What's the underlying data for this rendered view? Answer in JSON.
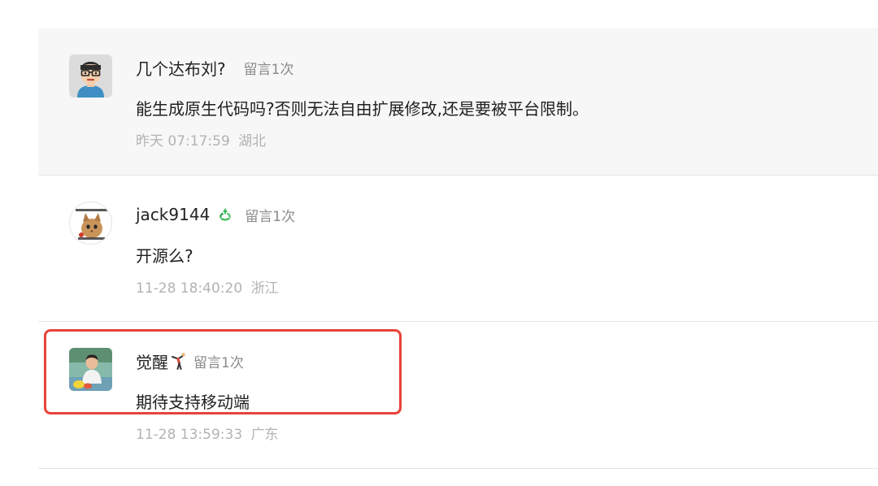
{
  "comments": [
    {
      "name": "几个达布刘?",
      "badge": "留言1次",
      "content": "能生成原生代码吗?否则无法自由扩展修改,还是要被平台限制。",
      "date": "昨天 07:17:59",
      "location": "湖北",
      "avatar_icon": "glasses-man-avatar"
    },
    {
      "name": "jack9144",
      "badge": "留言1次",
      "content": "开源么?",
      "date": "11-28 18:40:20",
      "location": "浙江",
      "avatar_icon": "cat-meme-avatar",
      "name_icon": "green-recycle-icon"
    },
    {
      "name": "觉醒",
      "badge": "留言1次",
      "content": "期待支持移动端",
      "date": "11-28 13:59:33",
      "location": "广东",
      "avatar_icon": "child-photo-avatar",
      "name_icon": "gymnast-icon"
    }
  ],
  "colors": {
    "highlight": "#e8433a",
    "verified": "#3dbb5a"
  }
}
